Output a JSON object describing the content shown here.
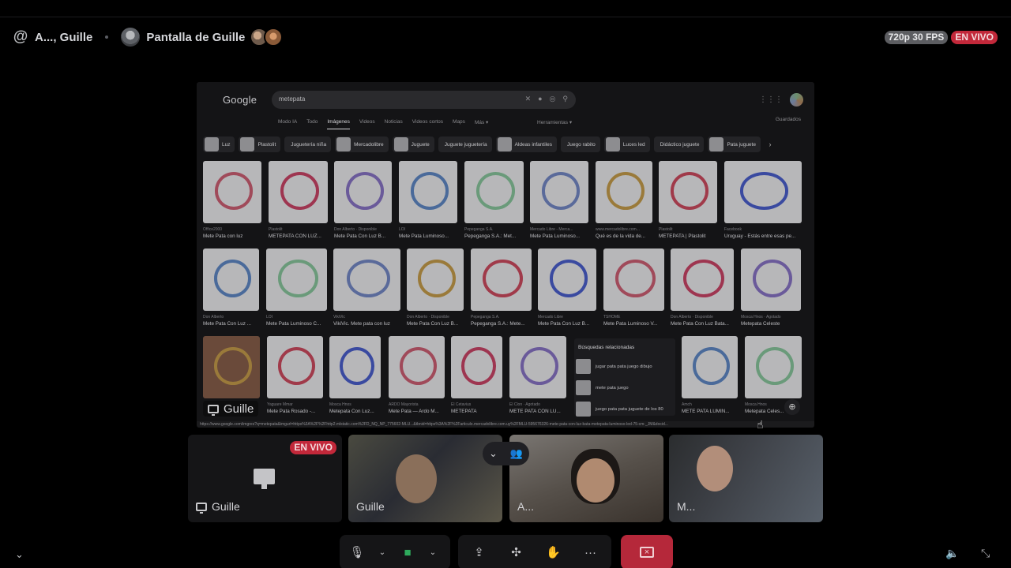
{
  "header": {
    "channel": "A..., Guille",
    "stream_title": "Pantalla de Guille",
    "quality": "720p 30 FPS",
    "live": "EN VIVO"
  },
  "google": {
    "logo": "Google",
    "query": "metepata",
    "tabs": [
      "Modo IA",
      "Todo",
      "Imágenes",
      "Videos",
      "Noticias",
      "Videos cortos",
      "Maps",
      "Más ▾"
    ],
    "active_tab": "Imágenes",
    "tools": "Herramientas ▾",
    "saved": "Guardados",
    "chips": [
      "Luz",
      "Plastolit",
      "Juguetería niña",
      "Mercadolibre",
      "Juguete",
      "Juguete juguetería",
      "Aldeas infantiles",
      "Juego rabito",
      "Luces led",
      "Didáctico juguete",
      "Pata juguete"
    ],
    "rows": [
      [
        {
          "src": "Office2000",
          "title": "Mete Pata con luz"
        },
        {
          "src": "Plastolit",
          "title": "METEPATA CON LUZ..."
        },
        {
          "src": "Don Alberto · Disponible",
          "title": "Mete Pata Con Luz B..."
        },
        {
          "src": "LOI",
          "title": "Mete Pata Luminoso..."
        },
        {
          "src": "Pepeganga S.A.",
          "title": "Pepeganga S.A.: Met..."
        },
        {
          "src": "Mercado Libre - Merca...",
          "title": "Mete Pata Luminoso..."
        },
        {
          "src": "www.mercadolibre.com...",
          "title": "Qué es de la vida de..."
        },
        {
          "src": "Plastolit",
          "title": "METEPATA | Plastolit"
        },
        {
          "src": "Facebook",
          "title": "Uruguay - Estás entre esas pe..."
        }
      ],
      [
        {
          "src": "Don Alberto",
          "title": "Mete Pata Con Luz ..."
        },
        {
          "src": "LOI",
          "title": "Mete Pata Luminoso C..."
        },
        {
          "src": "VikiVic",
          "title": "VikiVic. Mete pata con luz"
        },
        {
          "src": "Don Alberto · Disponible",
          "title": "Mete Pata Con Luz B..."
        },
        {
          "src": "Pepeganga S.A.",
          "title": "Pepeganga S.A.: Mete..."
        },
        {
          "src": "Mercado Libre",
          "title": "Mete Pata Con Luz B..."
        },
        {
          "src": "TSHOME",
          "title": "Mete Pata Luminoso V..."
        },
        {
          "src": "Don Alberto · Disponible",
          "title": "Mete Pata Con Luz Bata..."
        },
        {
          "src": "Mosca Hnos · Agotado",
          "title": "Metepata Celeste"
        }
      ],
      [
        {
          "src": "",
          "title": ""
        },
        {
          "src": "Yaguare Mmar",
          "title": "Mete Pata Rosado -..."
        },
        {
          "src": "Mosca Hnos",
          "title": "Metepata Con Luz..."
        },
        {
          "src": "ARDO Mayorista",
          "title": "Mete Pata — Ardo M..."
        },
        {
          "src": "El Cetavius",
          "title": "METEPATA"
        },
        {
          "src": "El Clon · Agotado",
          "title": "METE PATA CON LU..."
        },
        {
          "src": "Amch",
          "title": "METE PATA LUMIN..."
        },
        {
          "src": "Mosca Hnos",
          "title": "Metepata Celes..."
        }
      ]
    ],
    "related": {
      "heading": "Búsquedas relacionadas",
      "items": [
        "jugar pata pata juego dibujo",
        "mete pata juego",
        "juego pata pata juguete de los 80"
      ]
    },
    "status_url": "https://www.google.com/imgres?q=metepata&imgurl=https%3A%2F%2Fhttp2.mlstatic.com%2FD_NQ_NP_775602-MLU...&tbnid=https%3A%2F%2Farticulo.mercadolibre.com.uy%2FMLU-595676326-mete-pata-con-luz-bata-metepata-luminoso-led-75-cm-_JM&docid..."
  },
  "screen_name": "Guille",
  "participants": [
    {
      "name": "Guille",
      "live": "EN VIVO"
    },
    {
      "name": "Guille"
    },
    {
      "name": "A..."
    },
    {
      "name": "M..."
    }
  ],
  "colors": {
    "live": "#c2283a",
    "camera_on": "#2eaa5c",
    "end_call": "#b5283a"
  }
}
